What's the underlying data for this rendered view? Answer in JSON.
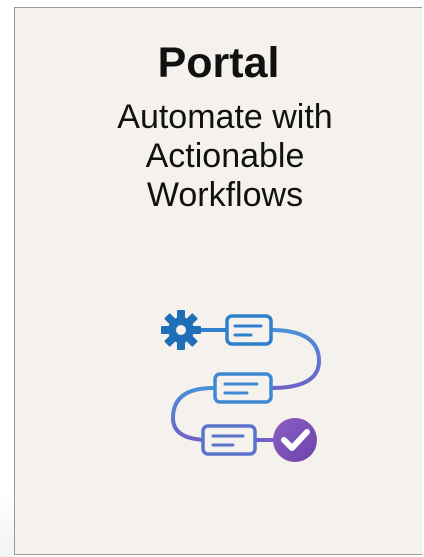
{
  "card": {
    "title": "Portal",
    "subtitle": "Automate with Actionable Workflows"
  },
  "illustration": {
    "icons": [
      "gear-icon",
      "document-icon",
      "checkmark-circle-icon"
    ],
    "colors": {
      "gear": "#1f6fb8",
      "cards": "#2f7fcd",
      "path_start": "#4c8fd8",
      "path_end": "#6f62c8",
      "check": "#7a52b8"
    }
  }
}
